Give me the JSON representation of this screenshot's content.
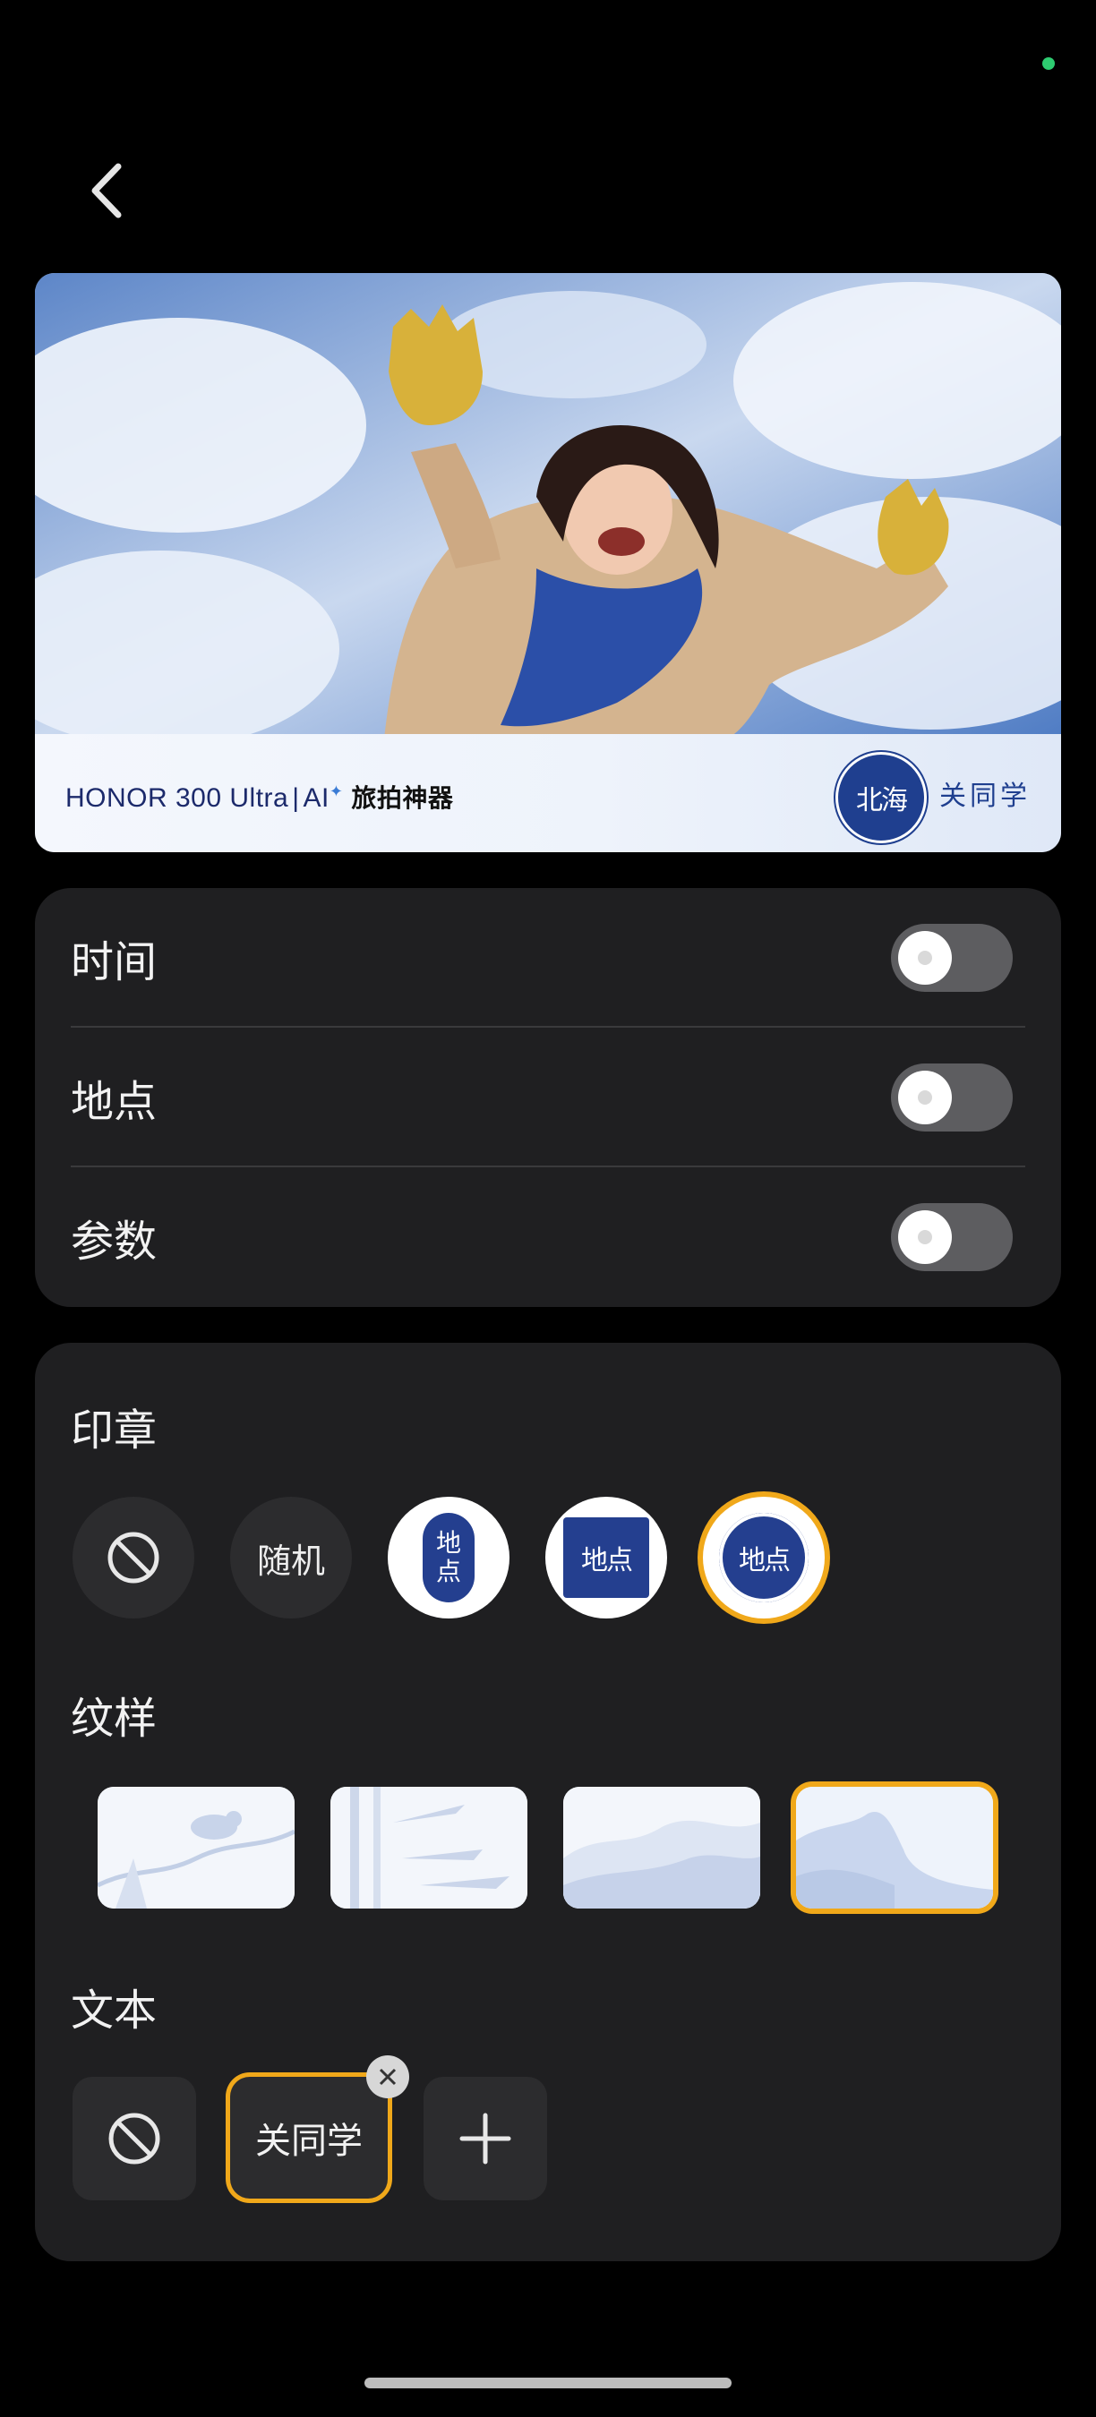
{
  "header": {
    "title": ""
  },
  "preview": {
    "brand": "HONOR 300 Ultra",
    "ai_label": "AI",
    "ai_star": "✦",
    "slogan": "旅拍神器",
    "seal_text": "北海",
    "author_text": "关同学"
  },
  "toggles": [
    {
      "label": "时间",
      "on": false
    },
    {
      "label": "地点",
      "on": false
    },
    {
      "label": "参数",
      "on": false
    }
  ],
  "stamp": {
    "title": "印章",
    "random_label": "随机",
    "options": [
      {
        "text_top": "地",
        "text_bottom": "点",
        "style": "oval"
      },
      {
        "text": "地点",
        "style": "square"
      },
      {
        "text": "地点",
        "style": "round",
        "selected": true
      }
    ]
  },
  "pattern": {
    "title": "纹样",
    "options": [
      "bird",
      "bamboo",
      "mountains",
      "clouds"
    ],
    "selected_index": 3
  },
  "text": {
    "title": "文本",
    "chip_label": "关同学"
  },
  "colors": {
    "accent": "#f0a81a",
    "card": "#1f1f21",
    "seal": "#243f8f"
  }
}
